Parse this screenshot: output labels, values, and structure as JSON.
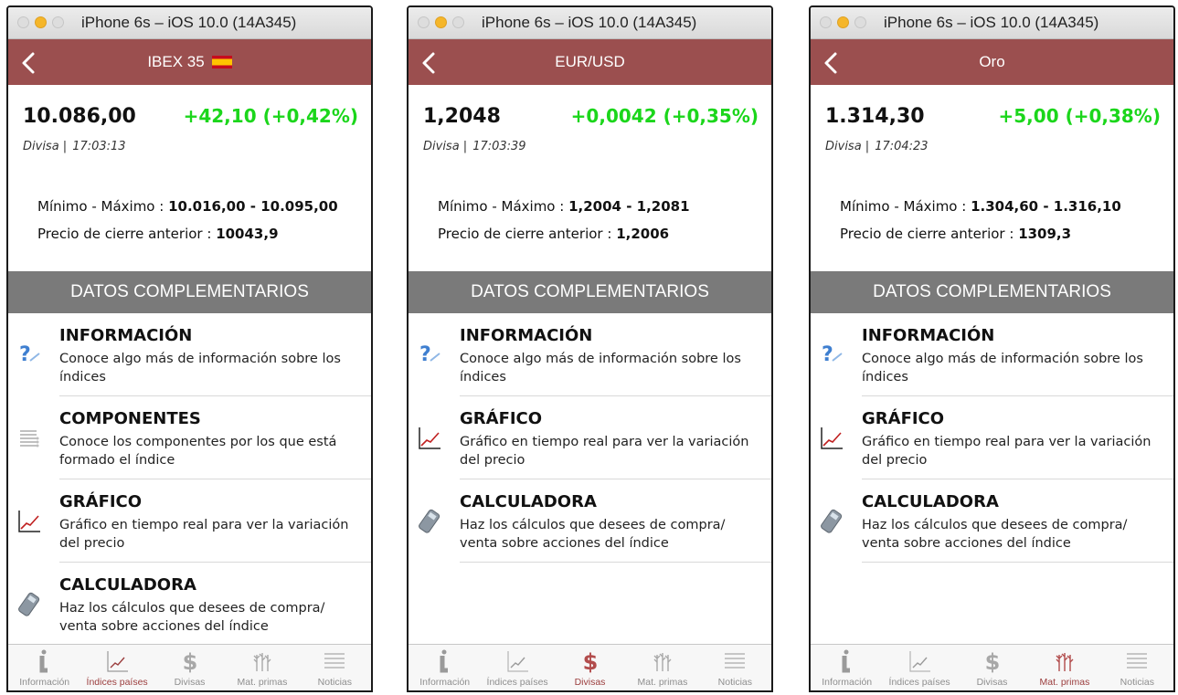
{
  "screens": [
    {
      "window_title": "iPhone 6s – iOS 10.0 (14A345)",
      "nav_title": "IBEX 35",
      "price": "10.086,00",
      "change": "+42,10 (+0,42%)",
      "label_type": "Divisa |",
      "time": "17:03:13",
      "range_label": "Mínimo - Máximo : ",
      "range_value": "10.016,00 - 10.095,00",
      "prev_label": "Precio de cierre anterior : ",
      "prev_value": "10043,9",
      "section_title": "DATOS COMPLEMENTARIOS",
      "rows": [
        {
          "title": "INFORMACIÓN",
          "desc": "Conoce algo más de información sobre los índices",
          "icon": "question-icon"
        },
        {
          "title": "COMPONENTES",
          "desc": "Conoce los componentes por los que está formado el índice",
          "icon": "list-icon"
        },
        {
          "title": "GRÁFICO",
          "desc": "Gráfico en tiempo real para ver la variación del precio",
          "icon": "chart-icon"
        },
        {
          "title": "CALCULADORA",
          "desc": "Haz los cálculos que desees de compra/ venta sobre acciones del índice",
          "icon": "calculator-icon"
        }
      ],
      "active_tab": 1
    },
    {
      "window_title": "iPhone 6s – iOS 10.0 (14A345)",
      "nav_title": "EUR/USD",
      "price": "1,2048",
      "change": "+0,0042 (+0,35%)",
      "label_type": "Divisa |",
      "time": "17:03:39",
      "range_label": "Mínimo - Máximo : ",
      "range_value": "1,2004 - 1,2081",
      "prev_label": "Precio de cierre anterior : ",
      "prev_value": "1,2006",
      "section_title": "DATOS COMPLEMENTARIOS",
      "rows": [
        {
          "title": "INFORMACIÓN",
          "desc": "Conoce algo más de información sobre los índices",
          "icon": "question-icon"
        },
        {
          "title": "GRÁFICO",
          "desc": "Gráfico en tiempo real para ver la variación del precio",
          "icon": "chart-icon"
        },
        {
          "title": "CALCULADORA",
          "desc": "Haz los cálculos que desees de compra/ venta sobre acciones del índice",
          "icon": "calculator-icon"
        }
      ],
      "active_tab": 2
    },
    {
      "window_title": "iPhone 6s – iOS 10.0 (14A345)",
      "nav_title": "Oro",
      "price": "1.314,30",
      "change": "+5,00 (+0,38%)",
      "label_type": "Divisa |",
      "time": "17:04:23",
      "range_label": "Mínimo - Máximo : ",
      "range_value": "1.304,60 - 1.316,10",
      "prev_label": "Precio de cierre anterior : ",
      "prev_value": "1309,3",
      "section_title": "DATOS COMPLEMENTARIOS",
      "rows": [
        {
          "title": "INFORMACIÓN",
          "desc": "Conoce algo más de información sobre los índices",
          "icon": "question-icon"
        },
        {
          "title": "GRÁFICO",
          "desc": "Gráfico en tiempo real para ver la variación del precio",
          "icon": "chart-icon"
        },
        {
          "title": "CALCULADORA",
          "desc": "Haz los cálculos que desees de compra/ venta sobre acciones del índice",
          "icon": "calculator-icon"
        }
      ],
      "active_tab": 3
    }
  ],
  "tabs": [
    {
      "label": "Información",
      "icon": "info-icon"
    },
    {
      "label": "Índices países",
      "icon": "chart-icon"
    },
    {
      "label": "Divisas",
      "icon": "dollar-icon"
    },
    {
      "label": "Mat. primas",
      "icon": "wheat-icon"
    },
    {
      "label": "Noticias",
      "icon": "list-icon"
    }
  ],
  "colors": {
    "navbar": "#9b4f4f",
    "positive_change": "#1bd61b",
    "section_header": "#7a7a7a",
    "active_tab": "#9b3d3d",
    "inactive_tab": "#8e8e8e"
  }
}
